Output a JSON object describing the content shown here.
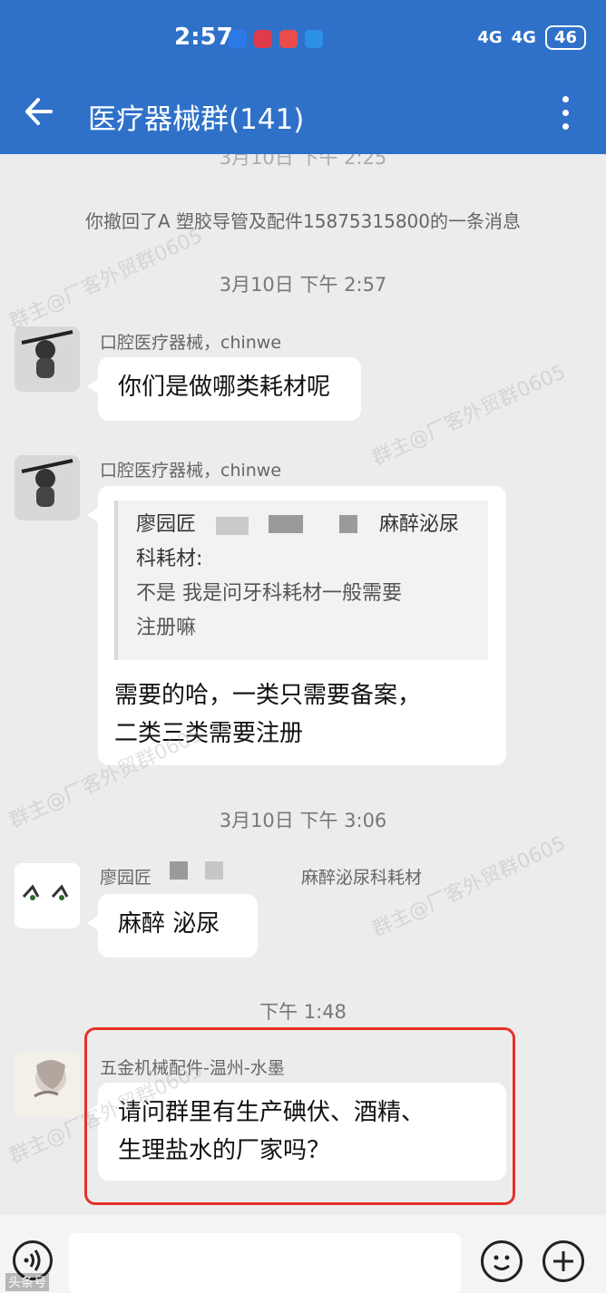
{
  "status": {
    "time": "2:57",
    "network": "4G",
    "battery": "46"
  },
  "header": {
    "title": "医疗器械群(141)"
  },
  "chat": {
    "top_time": "3月10日 下午 2:25",
    "system_message": "你撤回了A 塑胶导管及配件15875315800的一条消息",
    "time1": "3月10日 下午 2:57",
    "msg1": {
      "name": "口腔医疗器械，chinwe",
      "text": "你们是做哪类耗材呢"
    },
    "msg2": {
      "name": "口腔医疗器械，chinwe",
      "quote_name_start": "廖园匠",
      "quote_name_end": "麻醉泌尿",
      "quote_name_line2": "科耗材:",
      "quote_line1": "不是 我是问牙科耗材一般需要",
      "quote_line2": "注册嘛",
      "text_line1": "需要的哈，一类只需要备案，",
      "text_line2": "二类三类需要注册"
    },
    "time2": "3月10日 下午 3:06",
    "msg3": {
      "name_start": "廖园匠",
      "name_end": "麻醉泌尿科耗材",
      "text": "麻醉 泌尿"
    },
    "time3": "下午 1:48",
    "msg4": {
      "name": "五金机械配件-温州-水墨",
      "text_line1": "请问群里有生产碘伏、酒精、",
      "text_line2": "生理盐水的厂家吗？"
    },
    "watermark": "群主@厂客外贸群0605"
  },
  "footer": {
    "corner_watermark": "头条号"
  },
  "colors": {
    "header": "#2f71c9",
    "chat_background": "#ececec",
    "highlight_border": "#e53226"
  },
  "icons": [
    "back-arrow-icon",
    "more-vertical-icon",
    "voice-icon",
    "emoji-icon",
    "plus-icon"
  ]
}
